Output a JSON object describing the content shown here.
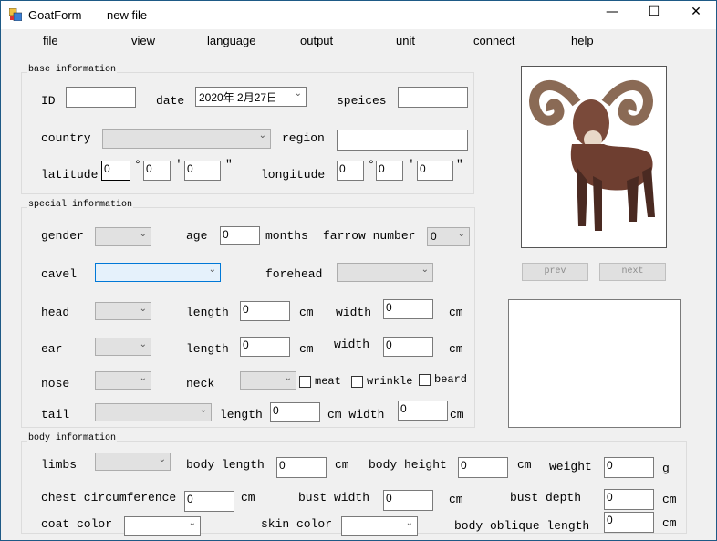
{
  "window": {
    "title": "GoatForm",
    "file_name": "new file",
    "controls": {
      "minimize": "—",
      "maximize": "☐",
      "close": "✕"
    }
  },
  "menu": [
    "file",
    "view",
    "language",
    "output",
    "unit",
    "connect",
    "help"
  ],
  "base": {
    "legend": "base information",
    "id_label": "ID",
    "id_value": "",
    "date_label": "date",
    "date_value": "2020年 2月27日",
    "species_label": "speices",
    "species_value": "",
    "country_label": "country",
    "country_value": "",
    "region_label": "region",
    "region_value": "",
    "latitude_label": "latitude",
    "lat_deg": "0",
    "lat_min": "0",
    "lat_sec": "0",
    "longitude_label": "longitude",
    "lon_deg": "0",
    "lon_min": "0",
    "lon_sec": "0",
    "deg_symbol": "°",
    "min_symbol": "'",
    "sec_symbol": "″"
  },
  "special": {
    "legend": "special information",
    "gender_label": "gender",
    "age_label": "age",
    "age_value": "0",
    "months_label": "months",
    "farrow_label": "farrow number",
    "farrow_value": "0",
    "cavel_label": "cavel",
    "forehead_label": "forehead",
    "head_label": "head",
    "length_label": "length",
    "width_label": "width",
    "cm": "cm",
    "head_length": "0",
    "head_width": "0",
    "ear_label": "ear",
    "ear_length": "0",
    "ear_width": "0",
    "nose_label": "nose",
    "neck_label": "neck",
    "meat_label": "meat",
    "wrinkle_label": "wrinkle",
    "beard_label": "beard",
    "tail_label": "tail",
    "tail_length": "0",
    "cm_width_label": "cm width",
    "tail_width": "0"
  },
  "body": {
    "legend": "body information",
    "limbs_label": "limbs",
    "body_length_label": "body length",
    "body_length": "0",
    "body_height_label": "body height",
    "body_height": "0",
    "weight_label": "weight",
    "weight": "0",
    "g": "g",
    "chest_label": "chest circumference",
    "chest": "0",
    "bust_width_label": "bust width",
    "bust_width": "0",
    "bust_depth_label": "bust depth",
    "bust_depth": "0",
    "coat_label": "coat color",
    "skin_label": "skin color",
    "oblique_label": "body oblique length",
    "oblique": "0",
    "cm": "cm"
  },
  "side": {
    "prev": "prev",
    "next": "next",
    "notes": ""
  },
  "colors": {
    "window_border": "#1e5a86",
    "goat": "#7a4a3a",
    "focus_blue": "#0078d7"
  }
}
